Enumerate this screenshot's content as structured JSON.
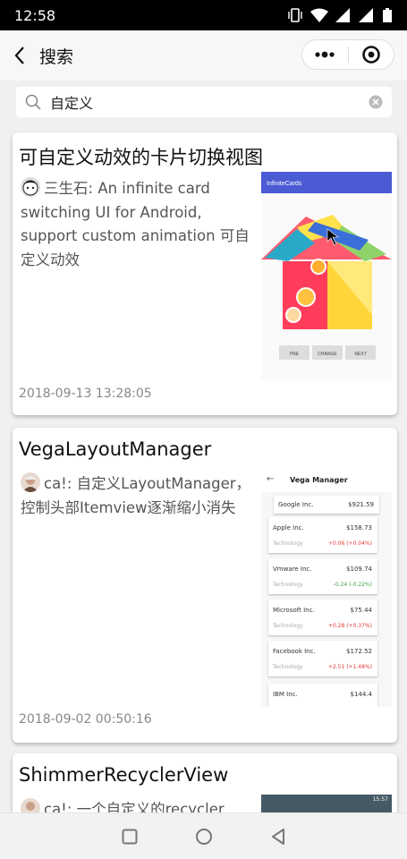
{
  "status": {
    "time": "12:58"
  },
  "nav": {
    "title": "搜索"
  },
  "search": {
    "value": "自定义"
  },
  "cards": [
    {
      "title": "可自定义动效的卡片切换视图",
      "author": "三生石",
      "text": "An infinite card switching UI for Android, support custom animation 可自定义动效",
      "date": "2018-09-13 13:28:05",
      "thumb": {
        "header": "InfiniteCards",
        "buttons": [
          "PRE",
          "CHANGE",
          "NEXT"
        ]
      }
    },
    {
      "title": "VegaLayoutManager",
      "author": "ca!",
      "text": "自定义LayoutManager，控制头部Itemview逐渐缩小消失",
      "date": "2018-09-02 00:50:16",
      "thumb": {
        "header": "Vega Manager",
        "top": {
          "name": "Google Inc.",
          "price": "$921.59"
        },
        "rows": [
          {
            "name": "Apple Inc.",
            "price": "$158.73",
            "sector": "Technology",
            "change": "+0.06 (+0.04%)",
            "color": "#e53935"
          },
          {
            "name": "Vmware Inc.",
            "price": "$109.74",
            "sector": "Technology",
            "change": "-0.24 (-0.22%)",
            "color": "#43a047"
          },
          {
            "name": "Microsoft Inc.",
            "price": "$75.44",
            "sector": "Technology",
            "change": "+0.28 (+0.37%)",
            "color": "#e53935"
          },
          {
            "name": "Facebook Inc.",
            "price": "$172.52",
            "sector": "Technology",
            "change": "+2.51 (+1.48%)",
            "color": "#e53935"
          },
          {
            "name": "IBM Inc.",
            "price": "$144.4"
          }
        ]
      }
    },
    {
      "title": "ShimmerRecyclerView",
      "author": "ca!",
      "text": "一个自定义的recycler",
      "thumb": {
        "status_time": "15:57"
      }
    }
  ]
}
